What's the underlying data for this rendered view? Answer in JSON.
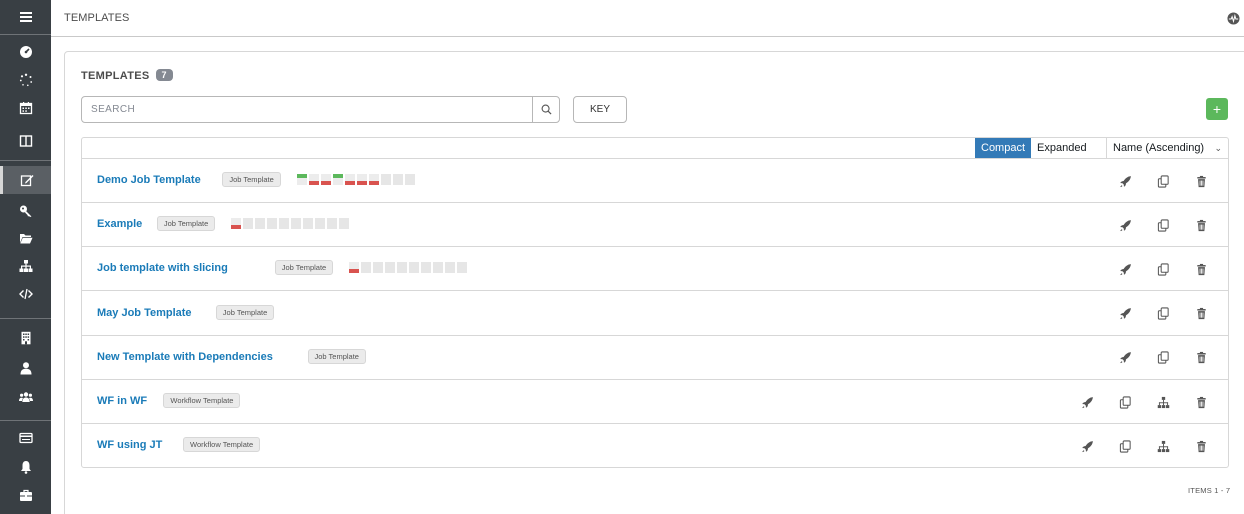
{
  "nav": {
    "items": [
      {
        "icon": "menu-icon",
        "active": false
      },
      {
        "icon": "dashboard-icon",
        "active": false
      },
      {
        "icon": "jobs-icon",
        "active": false
      },
      {
        "icon": "schedules-icon",
        "active": false
      },
      {
        "icon": "portal-icon",
        "active": false
      },
      {
        "icon": "templates-icon",
        "active": true
      },
      {
        "icon": "credentials-icon",
        "active": false
      },
      {
        "icon": "projects-icon",
        "active": false
      },
      {
        "icon": "inventories-icon",
        "active": false
      },
      {
        "icon": "inventory-scripts-icon",
        "active": false
      },
      {
        "icon": "organizations-icon",
        "active": false
      },
      {
        "icon": "users-icon",
        "active": false
      },
      {
        "icon": "teams-icon",
        "active": false
      },
      {
        "icon": "credential-types-icon",
        "active": false
      },
      {
        "icon": "notifications-icon",
        "active": false
      },
      {
        "icon": "management-jobs-icon",
        "active": false
      }
    ]
  },
  "header": {
    "breadcrumb": "TEMPLATES",
    "activity_icon": "activity-stream-icon"
  },
  "panel": {
    "title": "TEMPLATES",
    "count": "7",
    "search_placeholder": "SEARCH",
    "key_label": "KEY",
    "add_label": "+"
  },
  "list": {
    "view_compact": "Compact",
    "view_expanded": "Expanded",
    "sort_label": "Name (Ascending)",
    "rows": [
      {
        "name": "Demo Job Template",
        "type": "Job Template",
        "jobs": [
          "ok",
          "fail",
          "fail",
          "ok",
          "fail",
          "fail",
          "fail",
          "none",
          "none",
          "none"
        ],
        "actions": [
          "launch",
          "copy",
          "delete"
        ]
      },
      {
        "name": "Example",
        "type": "Job Template",
        "jobs": [
          "fail",
          "none",
          "none",
          "none",
          "none",
          "none",
          "none",
          "none",
          "none",
          "none"
        ],
        "actions": [
          "launch",
          "copy",
          "delete"
        ]
      },
      {
        "name": "Job template with slicing",
        "type": "Job Template",
        "jobs": [
          "fail",
          "none",
          "none",
          "none",
          "none",
          "none",
          "none",
          "none",
          "none",
          "none"
        ],
        "actions": [
          "launch",
          "copy",
          "delete"
        ]
      },
      {
        "name": "May Job Template",
        "type": "Job Template",
        "jobs": [],
        "actions": [
          "launch",
          "copy",
          "delete"
        ]
      },
      {
        "name": "New Template with Dependencies",
        "type": "Job Template",
        "jobs": [],
        "actions": [
          "launch",
          "copy",
          "delete"
        ]
      },
      {
        "name": "WF in WF",
        "type": "Workflow Template",
        "jobs": [],
        "actions": [
          "launch",
          "copy",
          "visualizer",
          "delete"
        ]
      },
      {
        "name": "WF using JT",
        "type": "Workflow Template",
        "jobs": [],
        "actions": [
          "launch",
          "copy",
          "visualizer",
          "delete"
        ]
      }
    ]
  },
  "footer": {
    "items_label": "ITEMS  1 - 7"
  },
  "colors": {
    "nav_bg": "#393f44",
    "link": "#1a7bb8",
    "success": "#5cb85c",
    "failed": "#d9534f",
    "toggle_selected": "#337ab7"
  }
}
